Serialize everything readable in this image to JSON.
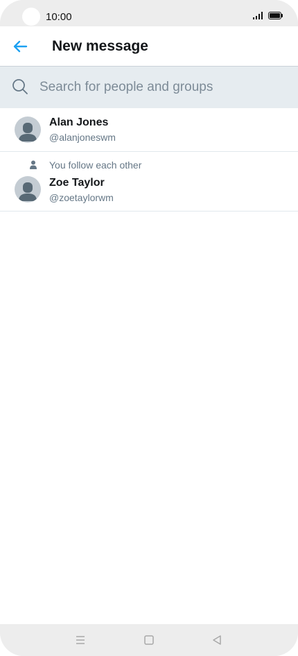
{
  "status_bar": {
    "time": "10:00"
  },
  "header": {
    "title": "New message",
    "back_icon": "arrow-left-icon"
  },
  "search": {
    "placeholder": "Search for people and groups",
    "value": ""
  },
  "contacts": [
    {
      "name": "Alan Jones",
      "handle": "@alanjoneswm",
      "social_context": ""
    },
    {
      "name": "Zoe Taylor",
      "handle": "@zoetaylorwm",
      "social_context": "You follow each other"
    }
  ],
  "colors": {
    "accent": "#1da1f2",
    "search_bg": "#e6ecf0",
    "secondary_text": "#657786",
    "avatar_bg": "#c4ccd3"
  },
  "nav": {
    "icons": [
      "menu-icon",
      "home-icon",
      "back-icon"
    ]
  }
}
